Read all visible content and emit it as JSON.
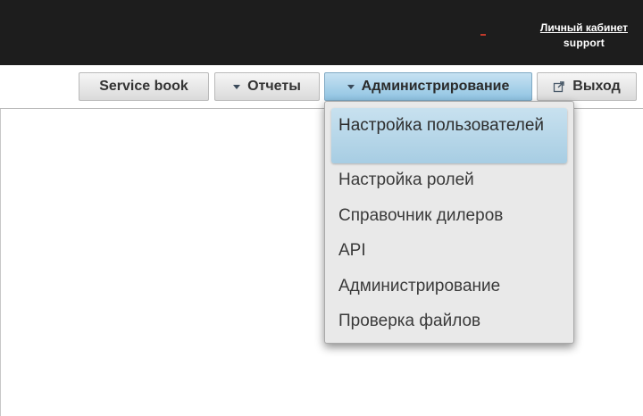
{
  "header": {
    "account_link": "Личный кабинет",
    "username": "support"
  },
  "nav": {
    "service_book": "Service book",
    "reports": "Отчеты",
    "administration": "Администрирование",
    "logout": "Выход"
  },
  "admin_menu": {
    "items": [
      "Настройка пользователей",
      "Настройка ролей",
      "Справочник дилеров",
      "API",
      "Администрирование",
      "Проверка файлов"
    ],
    "selected_index": 0
  },
  "colors": {
    "topbar": "#1d1d1d",
    "active_button": "#a7cde3",
    "menu_background": "#e9e9e9"
  }
}
